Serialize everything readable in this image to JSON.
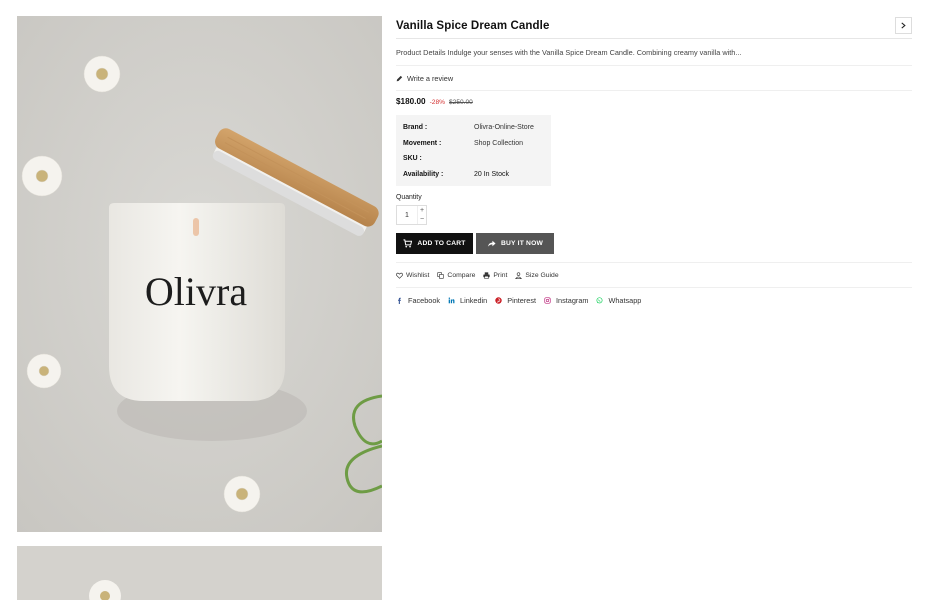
{
  "product": {
    "title": "Vanilla Spice Dream Candle",
    "description": "Product Details Indulge your senses with the Vanilla Spice Dream Candle. Combining creamy vanilla with...",
    "review_link": "Write a review",
    "price": "$180.00",
    "discount": "-28%",
    "compare_price": "$250.00",
    "image_brand_text": "Olivra"
  },
  "meta": [
    {
      "key": "Brand :",
      "value": "Olivra-Online-Store"
    },
    {
      "key": "Movement :",
      "value": "Shop Collection"
    },
    {
      "key": "SKU :",
      "value": ""
    },
    {
      "key": "Availability :",
      "value": "20 In Stock"
    }
  ],
  "quantity": {
    "label": "Quantity",
    "value": "1",
    "plus": "+",
    "minus": "−"
  },
  "buttons": {
    "add_to_cart": "ADD TO CART",
    "buy_now": "BUY IT NOW"
  },
  "actions": [
    {
      "label": "Wishlist",
      "icon": "heart-icon"
    },
    {
      "label": "Compare",
      "icon": "compare-icon"
    },
    {
      "label": "Print",
      "icon": "printer-icon"
    },
    {
      "label": "Size Guide",
      "icon": "ruler-icon"
    }
  ],
  "socials": [
    {
      "label": "Facebook",
      "icon": "facebook-icon",
      "color": "#3b5998"
    },
    {
      "label": "Linkedin",
      "icon": "linkedin-icon",
      "color": "#0077b5"
    },
    {
      "label": "Pinterest",
      "icon": "pinterest-icon",
      "color": "#cb2027"
    },
    {
      "label": "Instagram",
      "icon": "instagram-icon",
      "color": "#c13584"
    },
    {
      "label": "Whatsapp",
      "icon": "whatsapp-icon",
      "color": "#25d366"
    }
  ],
  "colors": {
    "button_dark": "#111111",
    "button_grey": "#555555",
    "discount_red": "#d32f2f"
  }
}
